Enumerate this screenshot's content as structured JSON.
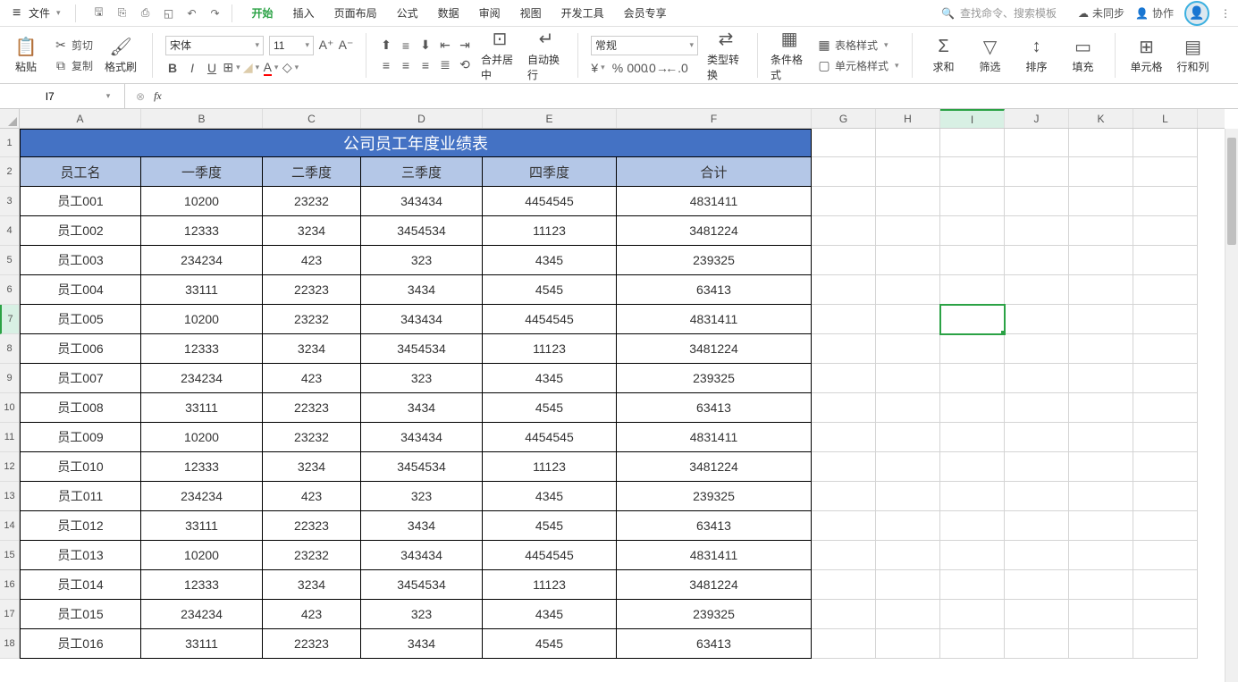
{
  "menubar": {
    "file": "文件"
  },
  "tabs": [
    "开始",
    "插入",
    "页面布局",
    "公式",
    "数据",
    "审阅",
    "视图",
    "开发工具",
    "会员专享"
  ],
  "search_placeholder": "查找命令、搜索模板",
  "right_tools": {
    "unsync": "未同步",
    "collab": "协作"
  },
  "ribbon": {
    "paste": "粘贴",
    "cut": "剪切",
    "copy": "复制",
    "format_painter": "格式刷",
    "font_name": "宋体",
    "font_size": "11",
    "merge": "合并居中",
    "wrap": "自动换行",
    "number_format": "常规",
    "type_convert": "类型转换",
    "cond_fmt": "条件格式",
    "table_style": "表格样式",
    "cell_style": "单元格样式",
    "sum": "求和",
    "filter": "筛选",
    "sort": "排序",
    "fill": "填充",
    "cell": "单元格",
    "rowcol": "行和列"
  },
  "name_box": "I7",
  "columns": [
    "A",
    "B",
    "C",
    "D",
    "E",
    "F",
    "G",
    "H",
    "I",
    "J",
    "K",
    "L"
  ],
  "selected_cell": {
    "col": "I",
    "row": 7
  },
  "table": {
    "title": "公司员工年度业绩表",
    "headers": [
      "员工名",
      "一季度",
      "二季度",
      "三季度",
      "四季度",
      "合计"
    ],
    "rows": [
      [
        "员工001",
        "10200",
        "23232",
        "343434",
        "4454545",
        "4831411"
      ],
      [
        "员工002",
        "12333",
        "3234",
        "3454534",
        "11123",
        "3481224"
      ],
      [
        "员工003",
        "234234",
        "423",
        "323",
        "4345",
        "239325"
      ],
      [
        "员工004",
        "33111",
        "22323",
        "3434",
        "4545",
        "63413"
      ],
      [
        "员工005",
        "10200",
        "23232",
        "343434",
        "4454545",
        "4831411"
      ],
      [
        "员工006",
        "12333",
        "3234",
        "3454534",
        "11123",
        "3481224"
      ],
      [
        "员工007",
        "234234",
        "423",
        "323",
        "4345",
        "239325"
      ],
      [
        "员工008",
        "33111",
        "22323",
        "3434",
        "4545",
        "63413"
      ],
      [
        "员工009",
        "10200",
        "23232",
        "343434",
        "4454545",
        "4831411"
      ],
      [
        "员工010",
        "12333",
        "3234",
        "3454534",
        "11123",
        "3481224"
      ],
      [
        "员工011",
        "234234",
        "423",
        "323",
        "4345",
        "239325"
      ],
      [
        "员工012",
        "33111",
        "22323",
        "3434",
        "4545",
        "63413"
      ],
      [
        "员工013",
        "10200",
        "23232",
        "343434",
        "4454545",
        "4831411"
      ],
      [
        "员工014",
        "12333",
        "3234",
        "3454534",
        "11123",
        "3481224"
      ],
      [
        "员工015",
        "234234",
        "423",
        "323",
        "4345",
        "239325"
      ],
      [
        "员工016",
        "33111",
        "22323",
        "3434",
        "4545",
        "63413"
      ]
    ]
  }
}
